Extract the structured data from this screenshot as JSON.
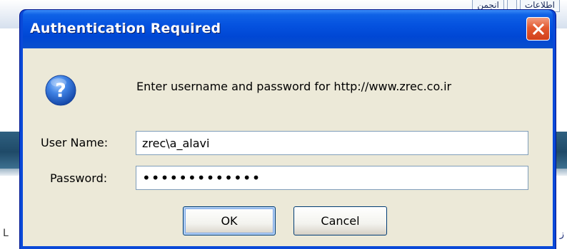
{
  "background": {
    "tabs": [
      "اطلاعات",
      "",
      "انجمن"
    ],
    "bottom_left_text": "L",
    "bottom_right_text": "ز"
  },
  "dialog": {
    "title": "Authentication Required",
    "close_icon": "close-icon",
    "help_icon": "question-icon",
    "prompt": "Enter username and password for http://www.zrec.co.ir",
    "username_label": "User Name:",
    "username_value": "zrec\\a_alavi",
    "password_label": "Password:",
    "password_value": "•••••••••••••",
    "ok_label": "OK",
    "cancel_label": "Cancel"
  },
  "colors": {
    "titlebar": "#0047d4",
    "client": "#ece9d8",
    "close_button": "#e35a30",
    "field_border": "#7f9db9",
    "help_icon": "#2f6fd6"
  }
}
